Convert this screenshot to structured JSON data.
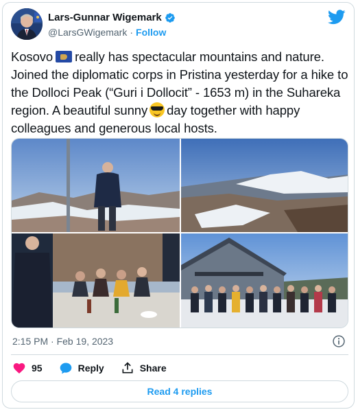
{
  "author": {
    "name": "Lars-Gunnar Wigemark",
    "handle": "@LarsGWigemark",
    "separator": "·",
    "follow_label": "Follow"
  },
  "tweet": {
    "line1_a": "Kosovo",
    "line1_b": "really has spectacular mountains and nature.",
    "line2": "Joined the diplomatic corps in Pristina yesterday for a hike to the Dolloci Peak (“Guri i Dollocit” - 1653 m) in the Suhareka region. A beautiful sunny",
    "line3": "day together with happy colleagues and generous local hosts.",
    "emoji_flag": "kosovo-flag-icon",
    "emoji_face": "sunglasses-face-icon"
  },
  "photos": [
    {
      "icon": "photo-man-on-summit"
    },
    {
      "icon": "photo-snowy-mountains"
    },
    {
      "icon": "photo-group-lunch"
    },
    {
      "icon": "photo-group-at-lodge"
    }
  ],
  "meta": {
    "timestamp": "2:15 PM · Feb 19, 2023"
  },
  "actions": {
    "likes": "95",
    "reply_label": "Reply",
    "share_label": "Share"
  },
  "replies_button": "Read 4 replies",
  "colors": {
    "accent": "#1d9bf0",
    "like": "#f91880",
    "text": "#0f1419",
    "muted": "#536471"
  }
}
